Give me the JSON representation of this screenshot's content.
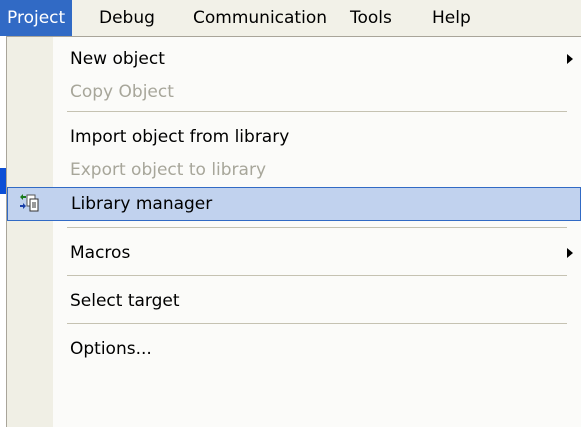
{
  "menubar": {
    "items": [
      {
        "label": "Project",
        "active": true
      },
      {
        "label": "Debug"
      },
      {
        "label": "Communication"
      },
      {
        "label": "Tools"
      },
      {
        "label": "Help"
      }
    ]
  },
  "menu": {
    "new_object": {
      "label": "New object",
      "has_submenu": true
    },
    "copy_object": {
      "label": "Copy Object",
      "enabled": false
    },
    "import_object": {
      "label": "Import object from library"
    },
    "export_object": {
      "label": "Export object to library",
      "enabled": false
    },
    "library_manager": {
      "label": "Library manager",
      "highlighted": true,
      "icon": "library-manager-icon"
    },
    "macros": {
      "label": "Macros",
      "has_submenu": true
    },
    "select_target": {
      "label": "Select target"
    },
    "options": {
      "label": "Options..."
    }
  },
  "colors": {
    "highlight_fill": "#c1d2ee",
    "highlight_border": "#316ac5",
    "active_menu": "#316ac5",
    "disabled_text": "#a7a69a"
  }
}
